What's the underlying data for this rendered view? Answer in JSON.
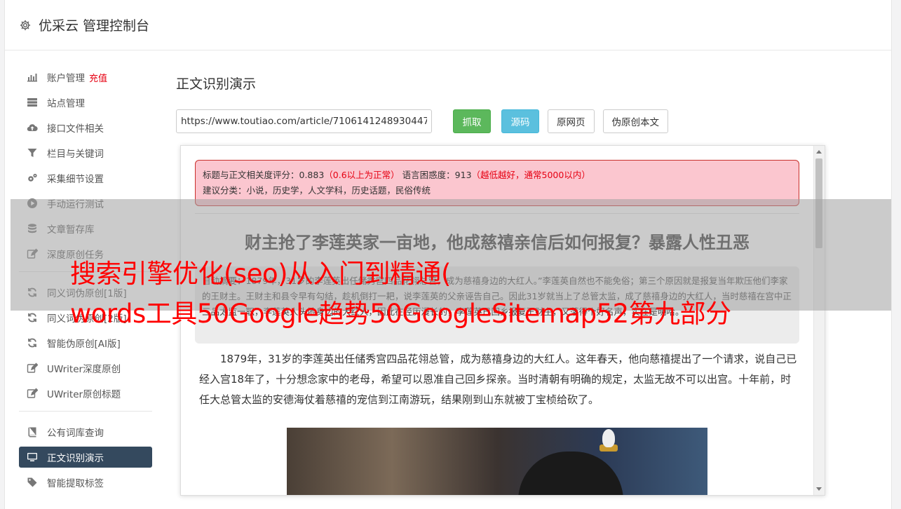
{
  "header": {
    "title": "优采云 管理控制台"
  },
  "sidebar": {
    "items": [
      {
        "label": "账户管理",
        "badge": "充值",
        "icon": "bar-chart-icon"
      },
      {
        "label": "站点管理",
        "icon": "server-icon"
      },
      {
        "label": "接口文件相关",
        "icon": "cloud-upload-icon"
      },
      {
        "label": "栏目与关键词",
        "icon": "filter-icon"
      },
      {
        "label": "采集细节设置",
        "icon": "cogs-icon"
      },
      {
        "label": "手动运行测试",
        "icon": "play-circle-icon"
      },
      {
        "label": "文章暂存库",
        "icon": "database-icon"
      },
      {
        "label": "深度原创任务",
        "icon": "edit-icon"
      },
      {
        "label": "同义词伪原创[1版]",
        "icon": "refresh-icon"
      },
      {
        "label": "同义词伪原创[2版]",
        "icon": "refresh-icon"
      },
      {
        "label": "智能伪原创[AI版]",
        "icon": "refresh-icon"
      },
      {
        "label": "UWriter深度原创",
        "icon": "edit-icon"
      },
      {
        "label": "UWriter原创标题",
        "icon": "edit-icon"
      },
      {
        "label": "公有词库查询",
        "icon": "book-icon"
      },
      {
        "label": "正文识别演示",
        "icon": "monitor-icon",
        "active": true
      },
      {
        "label": "智能提取标签",
        "icon": "tag-icon"
      }
    ]
  },
  "main": {
    "title": "正文识别演示",
    "url_value": "https://www.toutiao.com/article/7106141248930447",
    "buttons": {
      "fetch": "抓取",
      "source": "源码",
      "original_page": "原网页",
      "pseudo_original": "伪原创本文"
    },
    "alert": {
      "line1_label": "标题与正文相关度评分：0.883",
      "line1_warn": "（0.6以上为正常）",
      "line1_label2": "语言困惑度：913",
      "line1_warn2": "（越低越好，通常5000以内）",
      "line2": "建议分类：小说，历史学，人文学科，历史话题，民俗传统"
    },
    "article_title": "财主抢了李莲英家一亩地，他成慈禧亲信后如何报复？暴露人性丑恶",
    "summary": "自动摘要：1879年，31岁的李莲英出任储秀宫四品花翎总管，成为慈禧身边的大红人。”李莲英自然也不能免俗；第三个原因就是报复当年欺压他们李家的王财主。王财主和县令早有勾结，趁机倒打一耙，说李莲英的父亲诬告自己。因此31岁就当上了总管太监，成了慈禧身边的大红人，当时慈禧在宫中正三品太监一职，李莲英人头地身边的大红人，因此在经历漫长的，李莲英已回乡报复王财主，又落得个好名声，实在是明哈。",
    "paragraph": "1879年，31岁的李莲英出任储秀宫四品花翎总管，成为慈禧身边的大红人。这年春天，他向慈禧提出了一个请求，说自己已经入宫18年了，十分想念家中的老母，希望可以恩准自己回乡探亲。当时清朝有明确的规定，太监无故不可以出宫。十年前，时任大总管太监的安德海仗着慈禧的宠信到江南游玩，结果刚到山东就被丁宝桢给砍了。"
  },
  "overlay": {
    "line1": "搜索引擎优化(seo)从入门到精通(",
    "line2": "words工具50Google趋势50GoogleSitemap52第九部分"
  },
  "colors": {
    "active_nav": "#34495e",
    "fetch_btn": "#5cb85c",
    "source_btn": "#5bc0de",
    "alert_bg": "#fbc6cf",
    "warn": "#e60012"
  }
}
